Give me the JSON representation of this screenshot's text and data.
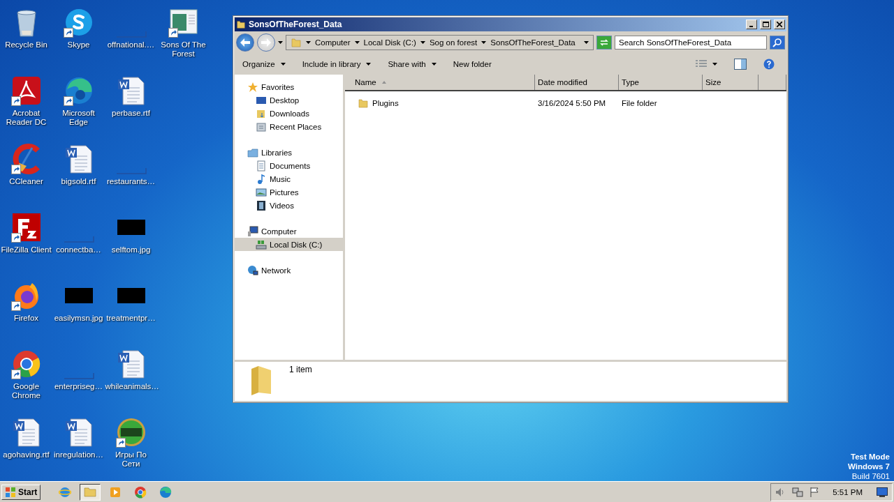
{
  "desktop_icons": [
    {
      "label": "Recycle Bin",
      "kind": "recycle",
      "shortcut": false
    },
    {
      "label": "Acrobat Reader DC",
      "kind": "acrobat",
      "shortcut": true
    },
    {
      "label": "CCleaner",
      "kind": "ccleaner",
      "shortcut": true
    },
    {
      "label": "FileZilla Client",
      "kind": "filezilla",
      "shortcut": true
    },
    {
      "label": "Firefox",
      "kind": "firefox",
      "shortcut": true
    },
    {
      "label": "Google Chrome",
      "kind": "chrome",
      "shortcut": true
    },
    {
      "label": "agohaving.rtf",
      "kind": "document",
      "shortcut": false
    },
    {
      "label": "Skype",
      "kind": "skype",
      "shortcut": true
    },
    {
      "label": "Microsoft Edge",
      "kind": "edge",
      "shortcut": true
    },
    {
      "label": "bigsold.rtf",
      "kind": "document",
      "shortcut": false
    },
    {
      "label": "connectba…",
      "kind": "blank",
      "shortcut": false
    },
    {
      "label": "easilymsn.jpg",
      "kind": "image",
      "shortcut": false
    },
    {
      "label": "enterpriseg…",
      "kind": "blank",
      "shortcut": false
    },
    {
      "label": "inregulation…",
      "kind": "document",
      "shortcut": false
    },
    {
      "label": "offnational.…",
      "kind": "blank",
      "shortcut": false
    },
    {
      "label": "perbase.rtf",
      "kind": "document",
      "shortcut": false
    },
    {
      "label": "restaurants…",
      "kind": "blank",
      "shortcut": false
    },
    {
      "label": "selftom.jpg",
      "kind": "image",
      "shortcut": false
    },
    {
      "label": "treatmentpr…",
      "kind": "image",
      "shortcut": false
    },
    {
      "label": "whileanimals…",
      "kind": "document",
      "shortcut": false
    },
    {
      "label": "Игры По Сети",
      "kind": "ftp",
      "shortcut": true
    },
    {
      "label": "Sons Of The Forest",
      "kind": "game",
      "shortcut": true
    }
  ],
  "window": {
    "title": "SonsOfTheForest_Data",
    "breadcrumbs": [
      "Computer",
      "Local Disk (C:)",
      "Sog on forest",
      "SonsOfTheForest_Data"
    ],
    "search": {
      "placeholder": "Search SonsOfTheForest_Data"
    },
    "toolbar": [
      {
        "label": "Organize",
        "dropdown": true
      },
      {
        "label": "Include in library",
        "dropdown": true
      },
      {
        "label": "Share with",
        "dropdown": true
      },
      {
        "label": "New folder",
        "dropdown": false
      }
    ],
    "navigation": [
      {
        "label": "Favorites",
        "kind": "star",
        "selected": false,
        "children": [
          {
            "label": "Desktop",
            "kind": "desktop",
            "selected": false
          },
          {
            "label": "Downloads",
            "kind": "downloads",
            "selected": false
          },
          {
            "label": "Recent Places",
            "kind": "recent",
            "selected": false
          }
        ]
      },
      {
        "label": "Libraries",
        "kind": "library",
        "selected": false,
        "children": [
          {
            "label": "Documents",
            "kind": "documents",
            "selected": false
          },
          {
            "label": "Music",
            "kind": "music",
            "selected": false
          },
          {
            "label": "Pictures",
            "kind": "pictures",
            "selected": false
          },
          {
            "label": "Videos",
            "kind": "videos",
            "selected": false
          }
        ]
      },
      {
        "label": "Computer",
        "kind": "computer",
        "selected": false,
        "children": [
          {
            "label": "Local Disk (C:)",
            "kind": "disk",
            "selected": true
          }
        ]
      },
      {
        "label": "Network",
        "kind": "network",
        "selected": false
      }
    ],
    "columns": [
      {
        "label": "Name",
        "sorted": true
      },
      {
        "label": "Date modified",
        "sorted": false
      },
      {
        "label": "Type",
        "sorted": false
      },
      {
        "label": "Size",
        "sorted": false
      }
    ],
    "rows": [
      {
        "name": "Plugins",
        "date_modified": "3/16/2024 5:50 PM",
        "type": "File folder"
      }
    ],
    "details": "1 item"
  },
  "watermark_info": [
    "Test Mode",
    "Windows 7",
    "Build 7601"
  ],
  "taskbar": {
    "start": "Start",
    "apps": [
      {
        "kind": "ie",
        "selected": false
      },
      {
        "kind": "explorer",
        "selected": true
      },
      {
        "kind": "media",
        "selected": false
      },
      {
        "kind": "chrome",
        "selected": false
      },
      {
        "kind": "edge",
        "selected": false
      }
    ],
    "time": "5:51 PM"
  }
}
